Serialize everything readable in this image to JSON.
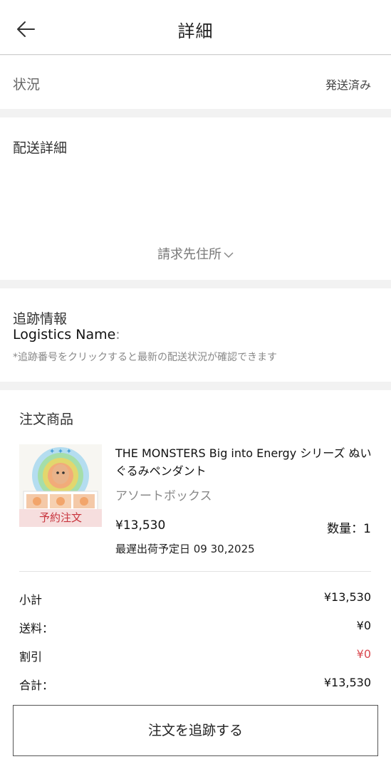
{
  "header": {
    "title": "詳細",
    "back_icon": "arrow-left-icon"
  },
  "status": {
    "label": "状況",
    "value": "発送済み"
  },
  "shipping": {
    "title": "配送詳細",
    "billing_toggle": "請求先住所",
    "toggle_icon": "chevron-down-icon"
  },
  "tracking": {
    "title": "追跡情報",
    "logistics_label": "Logistics Name",
    "logistics_colon": ":",
    "note": "*追跡番号をクリックすると最新の配送状況が確認できます"
  },
  "order": {
    "title": "注文商品",
    "product": {
      "name": "THE MONSTERS Big into Energy シリーズ ぬいぐるみペンダント",
      "variant": "アソートボックス",
      "badge": "予約注文",
      "price": "¥13,530",
      "quantity": "数量：1",
      "ship_date": "最遅出荷予定日 09 30,2025"
    },
    "summary": [
      {
        "label": "小計",
        "value": "¥13,530"
      },
      {
        "label": "送料：",
        "value": "¥0"
      },
      {
        "label": "割引",
        "value": "¥0"
      },
      {
        "label": "合計：",
        "value": "¥13,530"
      }
    ],
    "track_button": "注文を追跡する"
  },
  "colors": {
    "discount": "#d9484f",
    "badge_bg": "#f6dede",
    "badge_text": "#c8343d"
  }
}
